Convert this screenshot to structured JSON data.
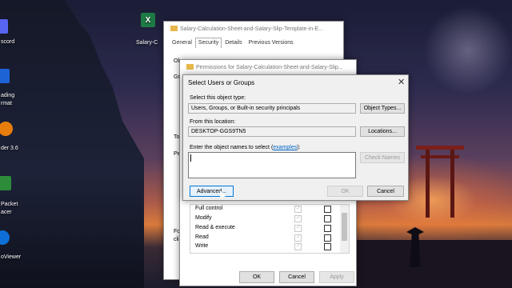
{
  "desktop": {
    "icons": [
      {
        "label": "scord",
        "color": "#5865f2"
      },
      {
        "label": "ading",
        "label2": "rmat",
        "color": "#1e63d6"
      },
      {
        "label": "der 3.6",
        "color": "#e87d0d"
      },
      {
        "label": "Packet",
        "label2": "acer",
        "color": "#2c8c3a"
      },
      {
        "label": "oViewer",
        "color": "#0e6fd8"
      },
      {
        "label": "Salary-C",
        "color": "#1d7a45"
      }
    ]
  },
  "properties_window": {
    "title": "Salary-Calculation-Sheet-and-Salary-Slip-Template-in-E...",
    "tabs": [
      "General",
      "Security",
      "Details",
      "Previous Versions"
    ],
    "active_tab": "Security",
    "fragments": {
      "ob": "Ob",
      "gr": "Gr",
      "to": "To",
      "pe": "Pe",
      "fo": "Fo",
      "cli": "cli"
    }
  },
  "permissions_window": {
    "title": "Permissions for Salary-Calculation-Sheet-and-Salary-Slip...",
    "permissions": [
      {
        "name": "Full control",
        "allow": true,
        "deny": false
      },
      {
        "name": "Modify",
        "allow": true,
        "deny": false
      },
      {
        "name": "Read & execute",
        "allow": true,
        "deny": false
      },
      {
        "name": "Read",
        "allow": true,
        "deny": false
      },
      {
        "name": "Write",
        "allow": true,
        "deny": false
      }
    ],
    "ok": "OK",
    "cancel": "Cancel",
    "apply": "Apply"
  },
  "select_dialog": {
    "title": "Select Users or Groups",
    "object_type_label": "Select this object type:",
    "object_type_value": "Users, Groups, or Built-in security principals",
    "object_types_button": "Object Types...",
    "location_label": "From this location:",
    "location_value": "DESKTOP-GGS9TN5",
    "locations_button": "Locations...",
    "names_label": "Enter the object names to select (",
    "names_link": "examples",
    "names_label_end": "):",
    "names_value": "",
    "check_names_button": "Check Names",
    "advanced_button": "Advanced...",
    "ok_button": "OK",
    "cancel_button": "Cancel",
    "close": "✕"
  }
}
